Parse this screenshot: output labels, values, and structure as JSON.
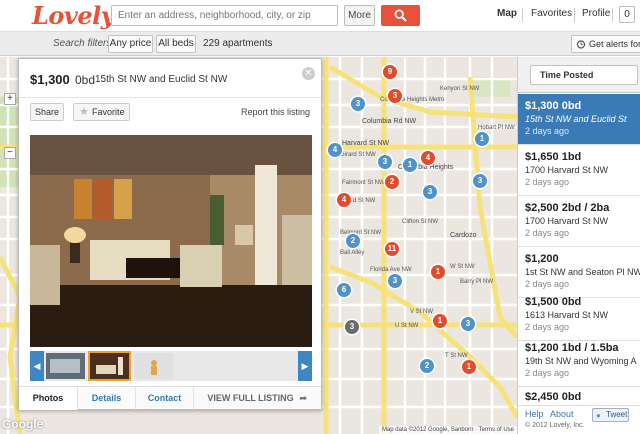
{
  "header": {
    "logo": "Lovely",
    "search_placeholder": "Enter an address, neighborhood, city, or zip",
    "more_label": "More",
    "nav": {
      "map": "Map",
      "favorites": "Favorites",
      "profile": "Profile",
      "count": "0"
    }
  },
  "filters": {
    "label": "Search filters:",
    "price": "Any price",
    "beds": "All beds",
    "count": "229 apartments",
    "alerts": "Get alerts for th"
  },
  "popup": {
    "price": "$1,300",
    "beds": "0bd",
    "address": "15th St NW and Euclid St NW",
    "share": "Share",
    "favorite": "Favorite",
    "report": "Report this listing",
    "tabs": {
      "photos": "Photos",
      "details": "Details",
      "contact": "Contact",
      "full": "VIEW FULL LISTING"
    }
  },
  "map": {
    "labels": {
      "columbia_rd": "Columbia Rd NW",
      "harvard": "Harvard St NW",
      "girard": "Girard St NW",
      "fairmont": "Fairmont St NW",
      "euclid": "Euclid St NW",
      "clifton": "Clifton St NW",
      "florida": "Florida Ave NW",
      "v_st": "V St NW",
      "u_st": "U St NW",
      "t_st": "T St NW",
      "columbia_heights": "Columbia Heights",
      "cardozo": "Cardozo",
      "hobart": "Hobart Pl NW",
      "kenyon": "Kenyon St NW",
      "metro": "Columbia Heights Metro",
      "belmont": "Belmont St NW",
      "w_st": "W St NW",
      "barry": "Barry Pl NW",
      "bali": "Bali Alley"
    },
    "markers": [
      "9",
      "3",
      "3",
      "1",
      "4",
      "3",
      "1",
      "4",
      "2",
      "4",
      "3",
      "3",
      "2",
      "11",
      "3",
      "1",
      "6",
      "3",
      "1",
      "3",
      "2",
      "1",
      "1",
      "1",
      "1"
    ],
    "attribution": "Map data ©2012 Google, Sanborn · Terms of Use",
    "google": "Google"
  },
  "sidebar": {
    "sort": "Time Posted",
    "listings": [
      {
        "title": "$1,300 0bd",
        "address": "15th St NW and Euclid St",
        "date": "2 days ago"
      },
      {
        "title": "$1,650 1bd",
        "address": "1700 Harvard St NW",
        "date": "2 days ago"
      },
      {
        "title": "$2,500 2bd / 2ba",
        "address": "1700 Harvard St NW",
        "date": "2 days ago"
      },
      {
        "title": "$1,200",
        "address": "1st St NW and Seaton Pl NW",
        "date": "2 days ago"
      },
      {
        "title": "$1,500 0bd",
        "address": "1613 Harvard St NW",
        "date": "2 days ago"
      },
      {
        "title": "$1,200 1bd / 1.5ba",
        "address": "19th St NW and Wyoming A",
        "date": "2 days ago"
      },
      {
        "title": "$2,450 0bd",
        "address": "",
        "date": ""
      }
    ],
    "footer": {
      "help": "Help",
      "about": "About",
      "copyright": "© 2012 Lovely, Inc.",
      "tweet": "Tweet",
      "tweet_count": "39"
    }
  }
}
